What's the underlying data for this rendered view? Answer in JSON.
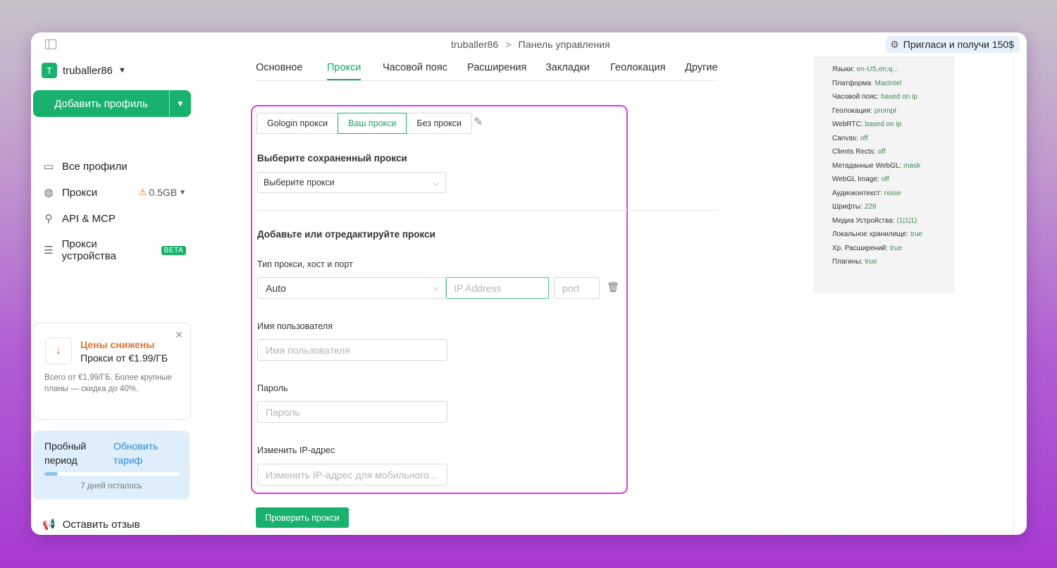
{
  "titlebar": {
    "workspace": "truballer86",
    "separator": ">",
    "page": "Панель управления",
    "invite_label": "Пригласи и получи 150$"
  },
  "sidebar": {
    "account_initial": "T",
    "account_name": "truballer86",
    "add_profile_label": "Добавить профиль",
    "items": [
      {
        "label": "Все профили",
        "icon": "profiles-inbox-icon"
      },
      {
        "label": "Прокси",
        "icon": "globe-icon",
        "extra": "0.5GB"
      },
      {
        "label": "API & MCP",
        "icon": "api-icon"
      },
      {
        "label": "Прокси устройства",
        "icon": "server-icon",
        "badge": "BETA"
      }
    ],
    "promo": {
      "title": "Цены снижены",
      "subtitle": "Прокси от €1.99/ГБ",
      "text": "Всего от €1,99/ГБ. Более крупные планы — скидка до 40%."
    },
    "trial": {
      "label": "Пробный период",
      "upgrade_link": "Обновить тариф",
      "days_left": "7 дней осталось",
      "progress_fraction": 0.1
    },
    "feedback_label": "Оставить отзыв"
  },
  "tabs": [
    {
      "label": "Основное"
    },
    {
      "label": "Прокси",
      "active": true
    },
    {
      "label": "Часовой пояс"
    },
    {
      "label": "Расширения"
    },
    {
      "label": "Закладки"
    },
    {
      "label": "Геолокация"
    },
    {
      "label": "Другие"
    }
  ],
  "proxy": {
    "mode_buttons": [
      "Gologin прокси",
      "Ваш прокси",
      "Без прокси"
    ],
    "active_mode": "Ваш прокси",
    "saved_title": "Выберите сохраненный прокси",
    "saved_select_value": "Выберите прокси",
    "edit_title": "Добавьте или отредактируйте прокси",
    "type_label": "Тип прокси, хост и порт",
    "type_value": "Auto",
    "ip_placeholder": "IP Address",
    "port_placeholder": "port",
    "username_label": "Имя пользователя",
    "username_placeholder": "Имя пользователя",
    "password_label": "Пароль",
    "password_placeholder": "Пароль",
    "change_ip_label": "Изменить IP-адрес",
    "change_ip_placeholder": "Изменить IP-адрес для мобильного...",
    "check_button": "Проверить прокси"
  },
  "fingerprint": [
    {
      "key": "Языки:",
      "value": "en-US,en;q..."
    },
    {
      "key": "Платформа:",
      "value": "MacIntel"
    },
    {
      "key": "Часовой пояс:",
      "value": "based on ip"
    },
    {
      "key": "Геолокация:",
      "value": "prompt"
    },
    {
      "key": "WebRTC:",
      "value": "based on ip"
    },
    {
      "key": "Canvas:",
      "value": "off"
    },
    {
      "key": "Clients Rects:",
      "value": "off"
    },
    {
      "key": "Метаданные WebGL:",
      "value": "mask"
    },
    {
      "key": "WebGL Image:",
      "value": "off"
    },
    {
      "key": "Аудиоконтекст:",
      "value": "noise"
    },
    {
      "key": "Шрифты:",
      "value": "228"
    },
    {
      "key": "Медиа Устройства:",
      "value": "(1|1|1)"
    },
    {
      "key": "Локальное хранилище:",
      "value": "true"
    },
    {
      "key": "Хр. Расширений:",
      "value": "true"
    },
    {
      "key": "Плагины:",
      "value": "true"
    }
  ],
  "colors": {
    "accent": "#18b26e",
    "highlight_border": "#e33ae0",
    "warning": "#e0732f",
    "link": "#2c8ad8"
  }
}
